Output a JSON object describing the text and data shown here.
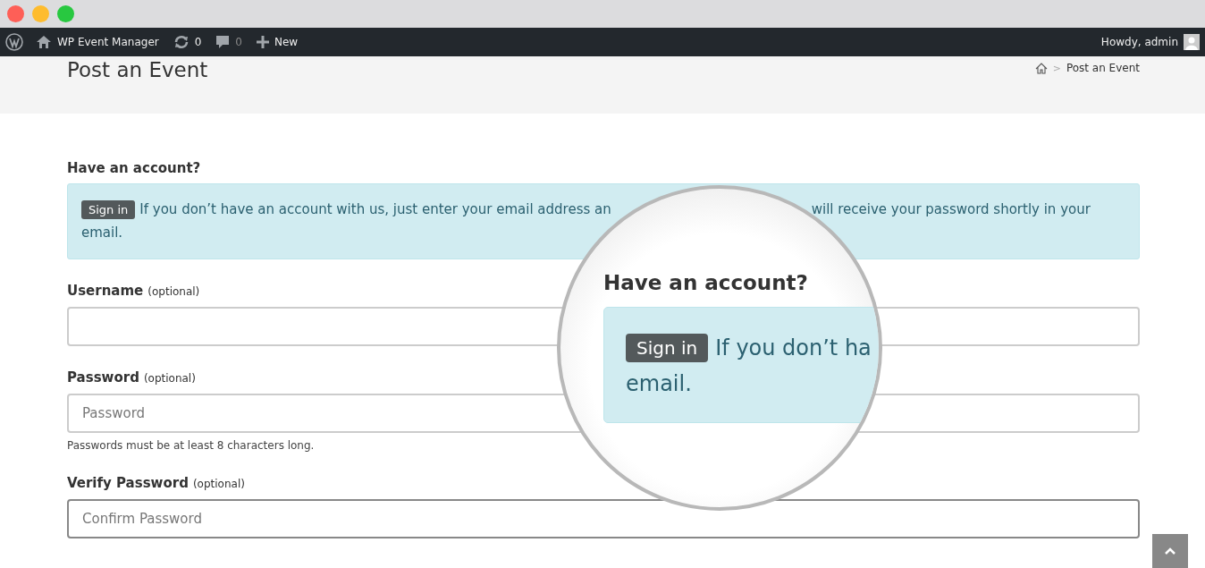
{
  "window": {
    "controls": [
      {
        "color": "#fe5f57"
      },
      {
        "color": "#febc2e"
      },
      {
        "color": "#28c840"
      }
    ]
  },
  "admin_bar": {
    "site": "WP Event Manager",
    "updates": "0",
    "comments": "0",
    "new": "New",
    "greeting": "Howdy, admin"
  },
  "header": {
    "title": "Post an Event",
    "breadcrumb": {
      "separator": ">",
      "current": "Post an Event"
    }
  },
  "form": {
    "heading": "Have an account?",
    "notice": {
      "sign_in": "Sign in",
      "text_before": "If you don’t have an account with us, just enter your email address an",
      "text_after": "will receive your password shortly in your",
      "text_end": "email."
    },
    "fields": [
      {
        "label": "Username",
        "hint": "(optional)",
        "focused": false
      },
      {
        "label": "Password",
        "hint": "(optional)",
        "placeholder": "Password",
        "help": "Passwords must be at least 8 characters long.",
        "focused": false
      },
      {
        "label": "Verify Password",
        "hint": "(optional)",
        "placeholder": "Confirm Password",
        "focused": true
      }
    ]
  },
  "magnifier": {
    "heading": "Have an account?",
    "sign_in": "Sign in",
    "text": "If you don’t ha",
    "text_end": "email."
  }
}
